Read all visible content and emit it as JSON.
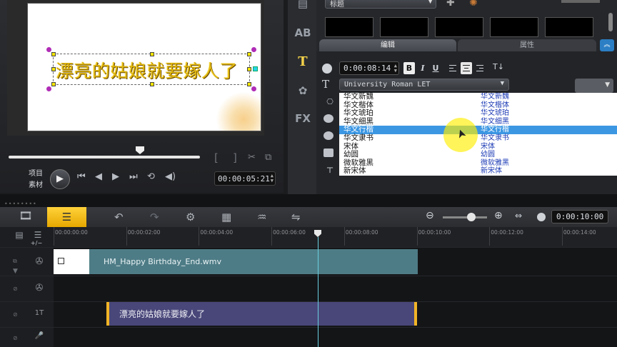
{
  "preview": {
    "title_text": "漂亮的姑娘就要嫁人了",
    "mode_project": "项目",
    "mode_clip": "素材",
    "timecode": "00:00:05:21",
    "mark_in": "[",
    "mark_out": "]"
  },
  "options": {
    "category": "标题",
    "tabs": {
      "edit": "编辑",
      "attributes": "属性"
    },
    "duration": "0:00:08:14",
    "format": {
      "bold": "B",
      "italic": "I",
      "underline": "U"
    },
    "font_name": "University Roman LET",
    "fonts": [
      {
        "name": "华文新魏",
        "preview": "华文新魏"
      },
      {
        "name": "华文楷体",
        "preview": "华文楷体"
      },
      {
        "name": "华文琥珀",
        "preview": "华文琥珀"
      },
      {
        "name": "华文细黑",
        "preview": "华文细黑"
      },
      {
        "name": "华文行楷",
        "preview": "华文行楷",
        "selected": true
      },
      {
        "name": "华文隶书",
        "preview": "华文隶书"
      },
      {
        "name": "宋体",
        "preview": "宋体"
      },
      {
        "name": "幼圆",
        "preview": "幼圆"
      },
      {
        "name": "微软雅黑",
        "preview": "微软雅黑"
      },
      {
        "name": "新宋体",
        "preview": "新宋体"
      }
    ],
    "side_icons": {
      "ab": "AB",
      "text": "T",
      "fx": "FX"
    }
  },
  "toolbar": {
    "project_timecode": "0:00:10:00"
  },
  "timeline": {
    "ruler_labels": [
      "00:00:00:00",
      "00:00:02:00",
      "00:00:04:00",
      "00:00:06:00",
      "00:00:08:00",
      "00:00:10:00",
      "00:00:12:00",
      "00:00:14:00"
    ],
    "video_clip": "HM_Happy Birthday_End.wmv",
    "title_clip": "漂亮的姑娘就要嫁人了",
    "title_track_label": "1T"
  },
  "colors": {
    "title_text": "#e2b80f",
    "timeline_button": "#ffc91f",
    "video_clip": "#4e7c86",
    "title_clip": "#494779",
    "selection": "#3c97e3",
    "playhead": "#6bcfe0"
  }
}
